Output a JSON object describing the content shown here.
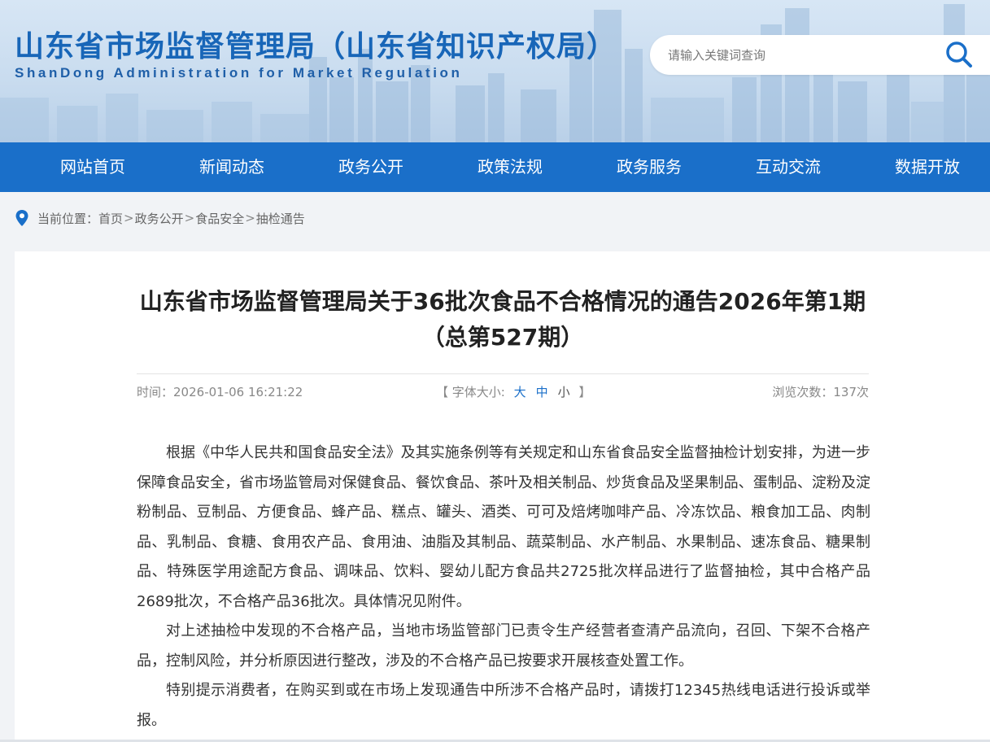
{
  "header": {
    "site_title": "山东省市场监督管理局（山东省知识产权局）",
    "site_subtitle": "ShanDong Administration for Market Regulation",
    "search_placeholder": "请输入关键词查询",
    "search_icon": "search-icon"
  },
  "nav": {
    "items": [
      "网站首页",
      "新闻动态",
      "政务公开",
      "政策法规",
      "政务服务",
      "互动交流",
      "数据开放"
    ]
  },
  "breadcrumb": {
    "icon": "location-pin-icon",
    "prefix": "当前位置：",
    "items": [
      "首页",
      "政务公开",
      "食品安全",
      "抽检通告"
    ],
    "separator": ">"
  },
  "article": {
    "title": "山东省市场监督管理局关于36批次食品不合格情况的通告2026年第1期（总第527期）",
    "time_label": "时间：",
    "time_value": "2026-01-06 16:21:22",
    "font_size_label": "【 字体大小:",
    "font_size_options": [
      "大",
      "中",
      "小"
    ],
    "font_size_close": "】",
    "views_label": "浏览次数：",
    "views_value": "137次",
    "paragraphs": [
      "根据《中华人民共和国食品安全法》及其实施条例等有关规定和山东省食品安全监督抽检计划安排，为进一步保障食品安全，省市场监管局对保健食品、餐饮食品、茶叶及相关制品、炒货食品及坚果制品、蛋制品、淀粉及淀粉制品、豆制品、方便食品、蜂产品、糕点、罐头、酒类、可可及焙烤咖啡产品、冷冻饮品、粮食加工品、肉制品、乳制品、食糖、食用农产品、食用油、油脂及其制品、蔬菜制品、水产制品、水果制品、速冻食品、糖果制品、特殊医学用途配方食品、调味品、饮料、婴幼儿配方食品共2725批次样品进行了监督抽检，其中合格产品2689批次，不合格产品36批次。具体情况见附件。",
      "对上述抽检中发现的不合格产品，当地市场监管部门已责令生产经营者查清产品流向，召回、下架不合格产品，控制风险，并分析原因进行整改，涉及的不合格产品已按要求开展核查处置工作。",
      "特别提示消费者，在购买到或在市场上发现通告中所涉不合格产品时，请拨打12345热线电话进行投诉或举报。"
    ]
  },
  "colors": {
    "brand_blue": "#1a6fc9",
    "title_blue": "#1866b8"
  }
}
